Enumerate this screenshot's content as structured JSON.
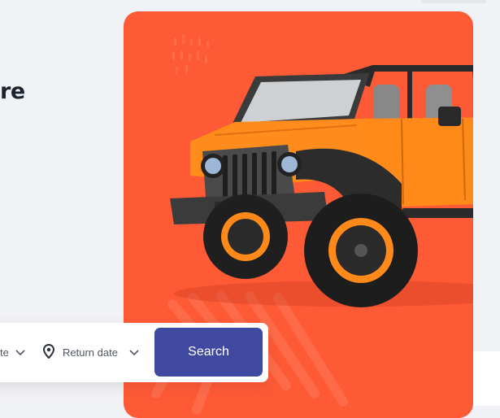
{
  "hero": {
    "title_fragment": "re"
  },
  "search": {
    "field_1_label": "te",
    "return_label": "Return date",
    "button_label": "Search"
  },
  "icons": {
    "field_1_chevron": "chevron-down-icon",
    "return_pin": "location-pin-icon",
    "return_chevron": "chevron-down-icon"
  },
  "colors": {
    "accent_orange": "#ff5a36",
    "button_blue": "#4049a0",
    "background": "#f1f2f5",
    "title_text": "#1e2330"
  },
  "image": {
    "subject": "orange-jeep-wrangler"
  }
}
